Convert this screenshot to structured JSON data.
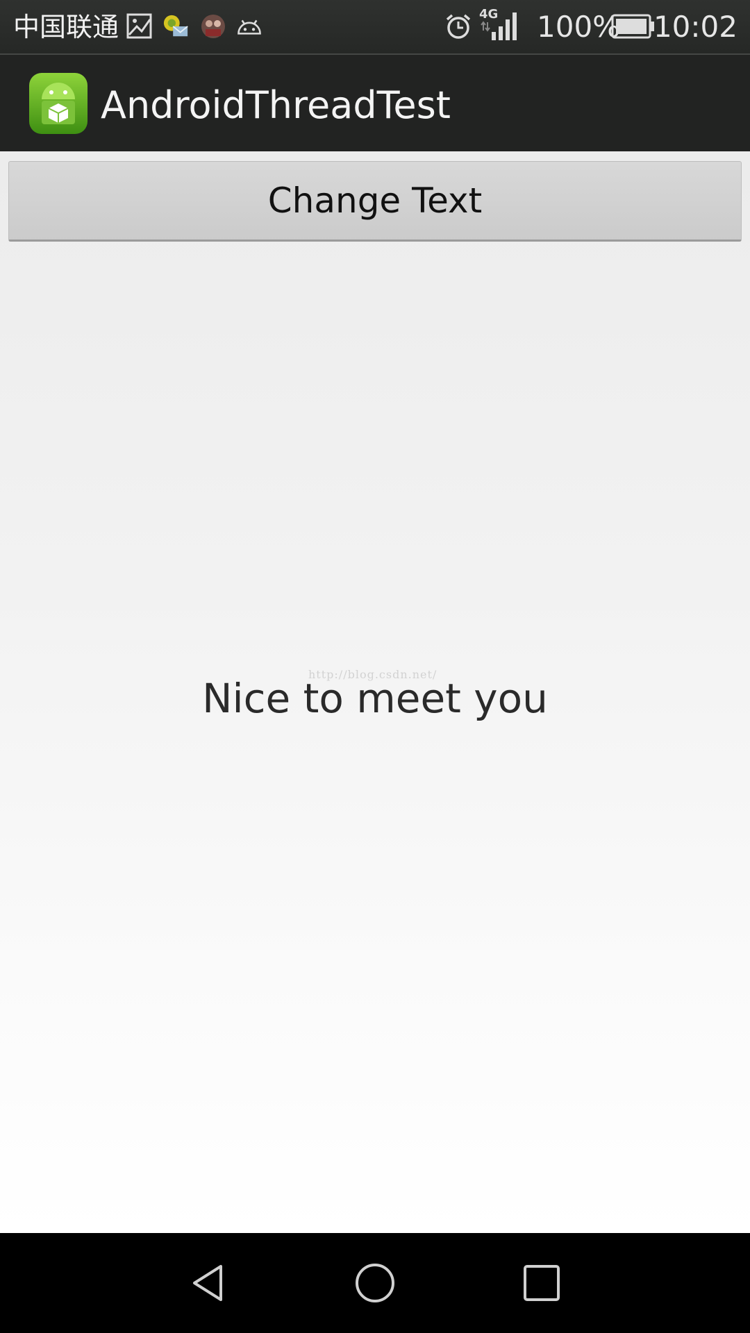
{
  "status_bar": {
    "carrier": "中国联通",
    "network": "4G",
    "battery_percent": "100%",
    "time": "10:02",
    "icons": [
      "gallery-icon",
      "mail-icon",
      "avatar-icon",
      "android-icon",
      "alarm-icon",
      "signal-icon",
      "battery-icon"
    ]
  },
  "app_bar": {
    "title": "AndroidThreadTest",
    "icon": "app-icon"
  },
  "main": {
    "button_label": "Change Text",
    "message": "Nice to meet you",
    "watermark": "http://blog.csdn.net/"
  },
  "nav_bar": {
    "buttons": [
      "back-icon",
      "home-icon",
      "recents-icon"
    ]
  },
  "colors": {
    "status_bar": "#2b2d2b",
    "app_bar": "#222322",
    "button": "#d0d0d0",
    "nav_bar": "#000000"
  }
}
